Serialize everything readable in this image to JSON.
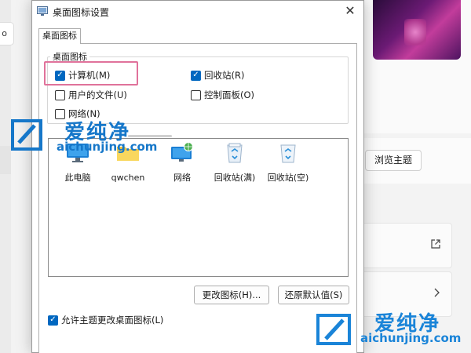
{
  "background": {
    "left_button_label": "o",
    "browse_theme_label": "浏览主题",
    "external_link_icon": "external-link-icon",
    "chevron_icon": "chevron-right-icon"
  },
  "dialog": {
    "title": "桌面图标设置",
    "close_glyph": "✕",
    "tab_label": "桌面图标",
    "group_label": "桌面图标",
    "checkboxes": [
      {
        "label": "计算机(M)",
        "checked": true
      },
      {
        "label": "回收站(R)",
        "checked": true
      },
      {
        "label": "用户的文件(U)",
        "checked": false
      },
      {
        "label": "控制面板(O)",
        "checked": false
      },
      {
        "label": "网络(N)",
        "checked": false
      }
    ],
    "icons": [
      {
        "label": "此电脑",
        "icon": "this-pc-icon"
      },
      {
        "label": "qwchen",
        "icon": "user-folder-icon"
      },
      {
        "label": "网络",
        "icon": "network-icon"
      },
      {
        "label": "回收站(满)",
        "icon": "recycle-bin-full-icon"
      },
      {
        "label": "回收站(空)",
        "icon": "recycle-bin-empty-icon"
      }
    ],
    "change_icon_button": "更改图标(H)...",
    "restore_default_button": "还原默认值(S)",
    "allow_themes": {
      "label": "允许主题更改桌面图标(L)",
      "checked": true
    }
  },
  "watermark": {
    "brand_cn": "爱纯净",
    "url": "aichunjing.com"
  },
  "colors": {
    "accent": "#0067c0",
    "highlight": "#e0729b",
    "watermark": "#1677c9"
  }
}
